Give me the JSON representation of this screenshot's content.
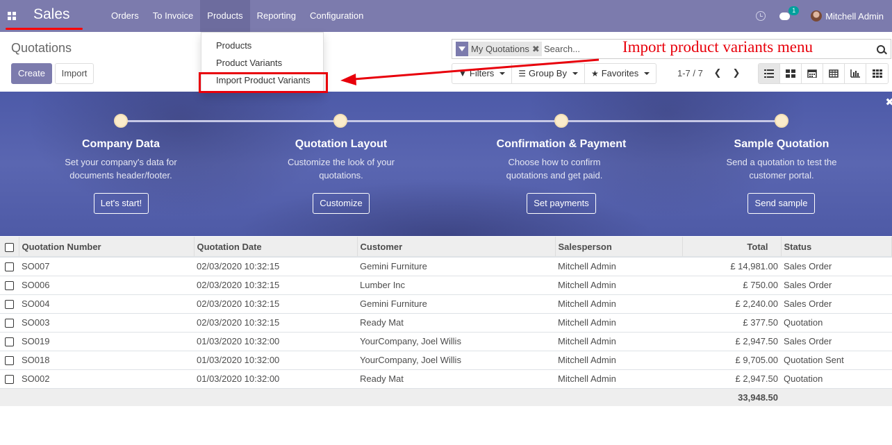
{
  "navbar": {
    "brand": "Sales",
    "menu": [
      "Orders",
      "To Invoice",
      "Products",
      "Reporting",
      "Configuration"
    ],
    "chat_count": "1",
    "user": "Mitchell Admin"
  },
  "dropdown": {
    "items": [
      "Products",
      "Product Variants",
      "Import Product Variants"
    ]
  },
  "annotation": "Import product variants menu",
  "control_panel": {
    "title": "Quotations",
    "create_label": "Create",
    "import_label": "Import",
    "facet": "My Quotations",
    "search_placeholder": "Search...",
    "filters": "Filters",
    "group_by": "Group By",
    "favorites": "Favorites",
    "pager": "1-7 / 7",
    "active_view": "list"
  },
  "banner": {
    "steps": [
      {
        "title": "Company Data",
        "desc": "Set your company's data for documents header/footer.",
        "button": "Let's start!"
      },
      {
        "title": "Quotation Layout",
        "desc": "Customize the look of your quotations.",
        "button": "Customize"
      },
      {
        "title": "Confirmation & Payment",
        "desc": "Choose how to confirm quotations and get paid.",
        "button": "Set payments"
      },
      {
        "title": "Sample Quotation",
        "desc": "Send a quotation to test the customer portal.",
        "button": "Send sample"
      }
    ],
    "colors": {
      "dot": "#fbeccb",
      "background": "#5a66b1"
    }
  },
  "table": {
    "columns": [
      "Quotation Number",
      "Quotation Date",
      "Customer",
      "Salesperson",
      "Total",
      "Status"
    ],
    "rows": [
      [
        "SO007",
        "02/03/2020 10:32:15",
        "Gemini Furniture",
        "Mitchell Admin",
        "£ 14,981.00",
        "Sales Order"
      ],
      [
        "SO006",
        "02/03/2020 10:32:15",
        "Lumber Inc",
        "Mitchell Admin",
        "£ 750.00",
        "Sales Order"
      ],
      [
        "SO004",
        "02/03/2020 10:32:15",
        "Gemini Furniture",
        "Mitchell Admin",
        "£ 2,240.00",
        "Sales Order"
      ],
      [
        "SO003",
        "02/03/2020 10:32:15",
        "Ready Mat",
        "Mitchell Admin",
        "£ 377.50",
        "Quotation"
      ],
      [
        "SO019",
        "01/03/2020 10:32:00",
        "YourCompany, Joel Willis",
        "Mitchell Admin",
        "£ 2,947.50",
        "Sales Order"
      ],
      [
        "SO018",
        "01/03/2020 10:32:00",
        "YourCompany, Joel Willis",
        "Mitchell Admin",
        "£ 9,705.00",
        "Quotation Sent"
      ],
      [
        "SO002",
        "01/03/2020 10:32:00",
        "Ready Mat",
        "Mitchell Admin",
        "£ 2,947.50",
        "Quotation"
      ]
    ],
    "total": "33,948.50"
  },
  "colors": {
    "brand": "#7c7bad",
    "annotation": "#e8000b"
  }
}
